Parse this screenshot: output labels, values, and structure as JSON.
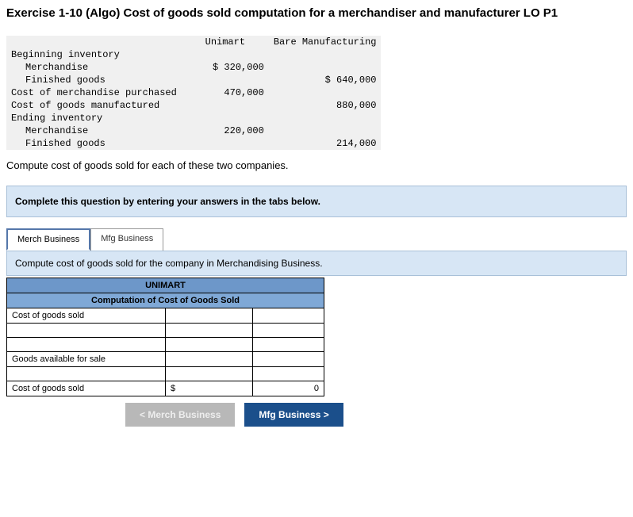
{
  "title": "Exercise 1-10 (Algo) Cost of goods sold computation for a merchandiser and manufacturer LO P1",
  "dataTable": {
    "colHeaders": {
      "c1": "Unimart",
      "c2": "Bare Manufacturing"
    },
    "rows": {
      "r0": "Beginning inventory",
      "r1": "Merchandise",
      "r1c1": "$ 320,000",
      "r1c2": "",
      "r2": "Finished goods",
      "r2c1": "",
      "r2c2": "$ 640,000",
      "r3": "Cost of merchandise purchased",
      "r3c1": "470,000",
      "r3c2": "",
      "r4": "Cost of goods manufactured",
      "r4c1": "",
      "r4c2": "880,000",
      "r5": "Ending inventory",
      "r6": "Merchandise",
      "r6c1": "220,000",
      "r6c2": "",
      "r7": "Finished goods",
      "r7c1": "",
      "r7c2": "214,000"
    }
  },
  "instruction": "Compute cost of goods sold for each of these two companies.",
  "blueBox": "Complete this question by entering your answers in the tabs below.",
  "tabs": {
    "t1": "Merch Business",
    "t2": "Mfg Business"
  },
  "tabInstruction": "Compute cost of goods sold for the company in Merchandising Business.",
  "compTable": {
    "header1": "UNIMART",
    "header2": "Computation of Cost of Goods Sold",
    "rows": {
      "r0": "Cost of goods sold",
      "r1": "",
      "r2": "",
      "r3": "Goods available for sale",
      "r4": "",
      "r5": "Cost of goods sold",
      "r5b": "$",
      "r5c": "0"
    }
  },
  "nav": {
    "prev": "Merch Business",
    "next": "Mfg Business"
  }
}
